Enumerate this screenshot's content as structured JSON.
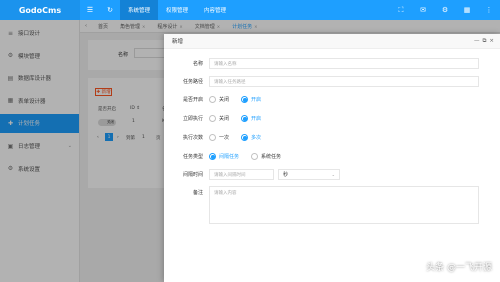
{
  "app": {
    "logo": "GodoCms"
  },
  "topbar": {
    "menu_icon": "☰",
    "refresh_icon": "↻",
    "tabs": [
      {
        "label": "系统管理"
      },
      {
        "label": "权限管理"
      },
      {
        "label": "内容管理"
      }
    ],
    "right_icons": [
      "⛶",
      "✉",
      "⚙",
      "▦",
      "⋮"
    ]
  },
  "sidebar": {
    "items": [
      {
        "icon": "≡",
        "label": "接口设计"
      },
      {
        "icon": "⚙",
        "label": "模块管理"
      },
      {
        "icon": "▤",
        "label": "数据库设计器"
      },
      {
        "icon": "▦",
        "label": "表单设计器"
      },
      {
        "icon": "✚",
        "label": "计划任务"
      },
      {
        "icon": "▣",
        "label": "日志管理",
        "chevron": "⌄"
      },
      {
        "icon": "⚙",
        "label": "系统设置"
      }
    ]
  },
  "tabbar": {
    "prev": "‹",
    "next": "›",
    "crumbs": [
      {
        "label": "首页"
      },
      {
        "label": "角色管理"
      },
      {
        "label": "程序设计"
      },
      {
        "label": "文档管理"
      },
      {
        "label": "计划任务"
      }
    ],
    "close_mark": "×"
  },
  "background": {
    "search_label": "名称",
    "add_button": "✚ 新增",
    "headers": [
      "是否开启",
      "ID ⇕",
      "名"
    ],
    "row": {
      "toggle": "关闭",
      "id": "1",
      "name": "K"
    },
    "pager": {
      "prev": "‹",
      "page": "1",
      "next": "›",
      "goto": "到第",
      "goto_page": "1",
      "unit": "页"
    }
  },
  "modal": {
    "title": "新增",
    "tools": [
      "—",
      "⧉",
      "×"
    ],
    "fields": {
      "name": {
        "label": "名称",
        "placeholder": "请输入名称"
      },
      "path": {
        "label": "任务路径",
        "placeholder": "请输入任务路径"
      },
      "enabled": {
        "label": "是否开启",
        "options": [
          "关闭",
          "开启"
        ],
        "selected": 1
      },
      "run_now": {
        "label": "立即执行",
        "options": [
          "关闭",
          "开启"
        ],
        "selected": 1
      },
      "exec_times": {
        "label": "执行次数",
        "options": [
          "一次",
          "多次"
        ],
        "selected": 1
      },
      "task_type": {
        "label": "任务类型",
        "options": [
          "间隔任务",
          "系统任务"
        ],
        "selected": 0
      },
      "interval": {
        "label": "间隔时间",
        "placeholder": "请输入间隔时间",
        "unit": "秒",
        "caret": "⌄"
      },
      "remark": {
        "label": "备注",
        "placeholder": "请输入内容"
      }
    }
  },
  "watermark": "头条 @一飞开源",
  "colors": {
    "primary": "#1e9fff",
    "danger": "#ff5722"
  }
}
